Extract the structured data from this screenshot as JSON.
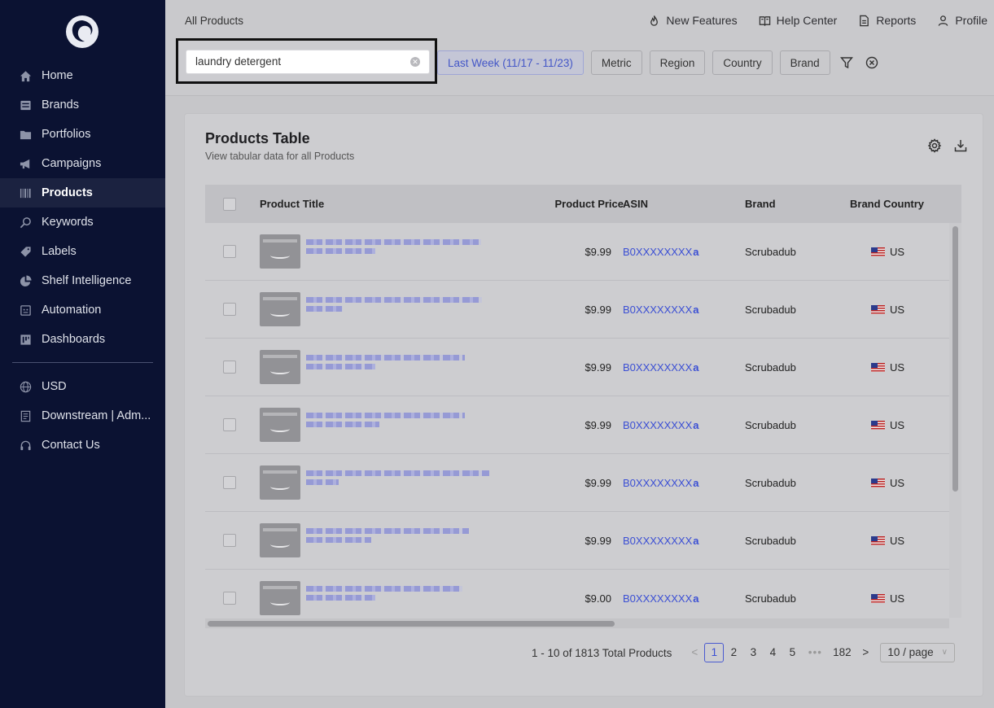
{
  "sidebar": {
    "items": [
      {
        "label": "Home",
        "icon": "home-icon"
      },
      {
        "label": "Brands",
        "icon": "brands-icon"
      },
      {
        "label": "Portfolios",
        "icon": "folder-icon"
      },
      {
        "label": "Campaigns",
        "icon": "megaphone-icon"
      },
      {
        "label": "Products",
        "icon": "barcode-icon"
      },
      {
        "label": "Keywords",
        "icon": "search-icon"
      },
      {
        "label": "Labels",
        "icon": "tag-icon"
      },
      {
        "label": "Shelf Intelligence",
        "icon": "pie-chart-icon"
      },
      {
        "label": "Automation",
        "icon": "automation-icon"
      },
      {
        "label": "Dashboards",
        "icon": "dashboard-icon"
      }
    ],
    "lower_items": [
      {
        "label": "USD",
        "icon": "globe-icon"
      },
      {
        "label": "Downstream | Adm...",
        "icon": "document-icon"
      },
      {
        "label": "Contact Us",
        "icon": "headset-icon"
      }
    ]
  },
  "header": {
    "breadcrumb": "All Products",
    "links": {
      "new_features": "New Features",
      "help_center": "Help Center",
      "reports": "Reports",
      "profile": "Profile"
    }
  },
  "filters": {
    "search_value": "laundry detergent",
    "date_chip": "Last Week (11/17 - 11/23)",
    "metric": "Metric",
    "region": "Region",
    "country": "Country",
    "brand": "Brand"
  },
  "card": {
    "title": "Products Table",
    "subtitle": "View tabular data for all Products"
  },
  "table": {
    "columns": {
      "title": "Product Title",
      "price": "Product Price",
      "asin": "ASIN",
      "brand": "Brand",
      "country": "Brand Country"
    },
    "rows": [
      {
        "price": "$9.99",
        "asin": "B0XXXXXXXX",
        "brand": "Scrubadub",
        "country": "US"
      },
      {
        "price": "$9.99",
        "asin": "B0XXXXXXXX",
        "brand": "Scrubadub",
        "country": "US"
      },
      {
        "price": "$9.99",
        "asin": "B0XXXXXXXX",
        "brand": "Scrubadub",
        "country": "US"
      },
      {
        "price": "$9.99",
        "asin": "B0XXXXXXXX",
        "brand": "Scrubadub",
        "country": "US"
      },
      {
        "price": "$9.99",
        "asin": "B0XXXXXXXX",
        "brand": "Scrubadub",
        "country": "US"
      },
      {
        "price": "$9.99",
        "asin": "B0XXXXXXXX",
        "brand": "Scrubadub",
        "country": "US"
      },
      {
        "price": "$9.00",
        "asin": "B0XXXXXXXX",
        "brand": "Scrubadub",
        "country": "US"
      }
    ],
    "amazon_glyph": "a"
  },
  "pagination": {
    "total_text": "1 - 10 of 1813 Total Products",
    "prev": "<",
    "pages": [
      "1",
      "2",
      "3",
      "4",
      "5"
    ],
    "dots": "•••",
    "last_page": "182",
    "next": ">",
    "page_size": "10 / page",
    "current_page": 1
  },
  "colors": {
    "sidebar_bg": "#0b1232",
    "accent": "#3b4fd4"
  }
}
